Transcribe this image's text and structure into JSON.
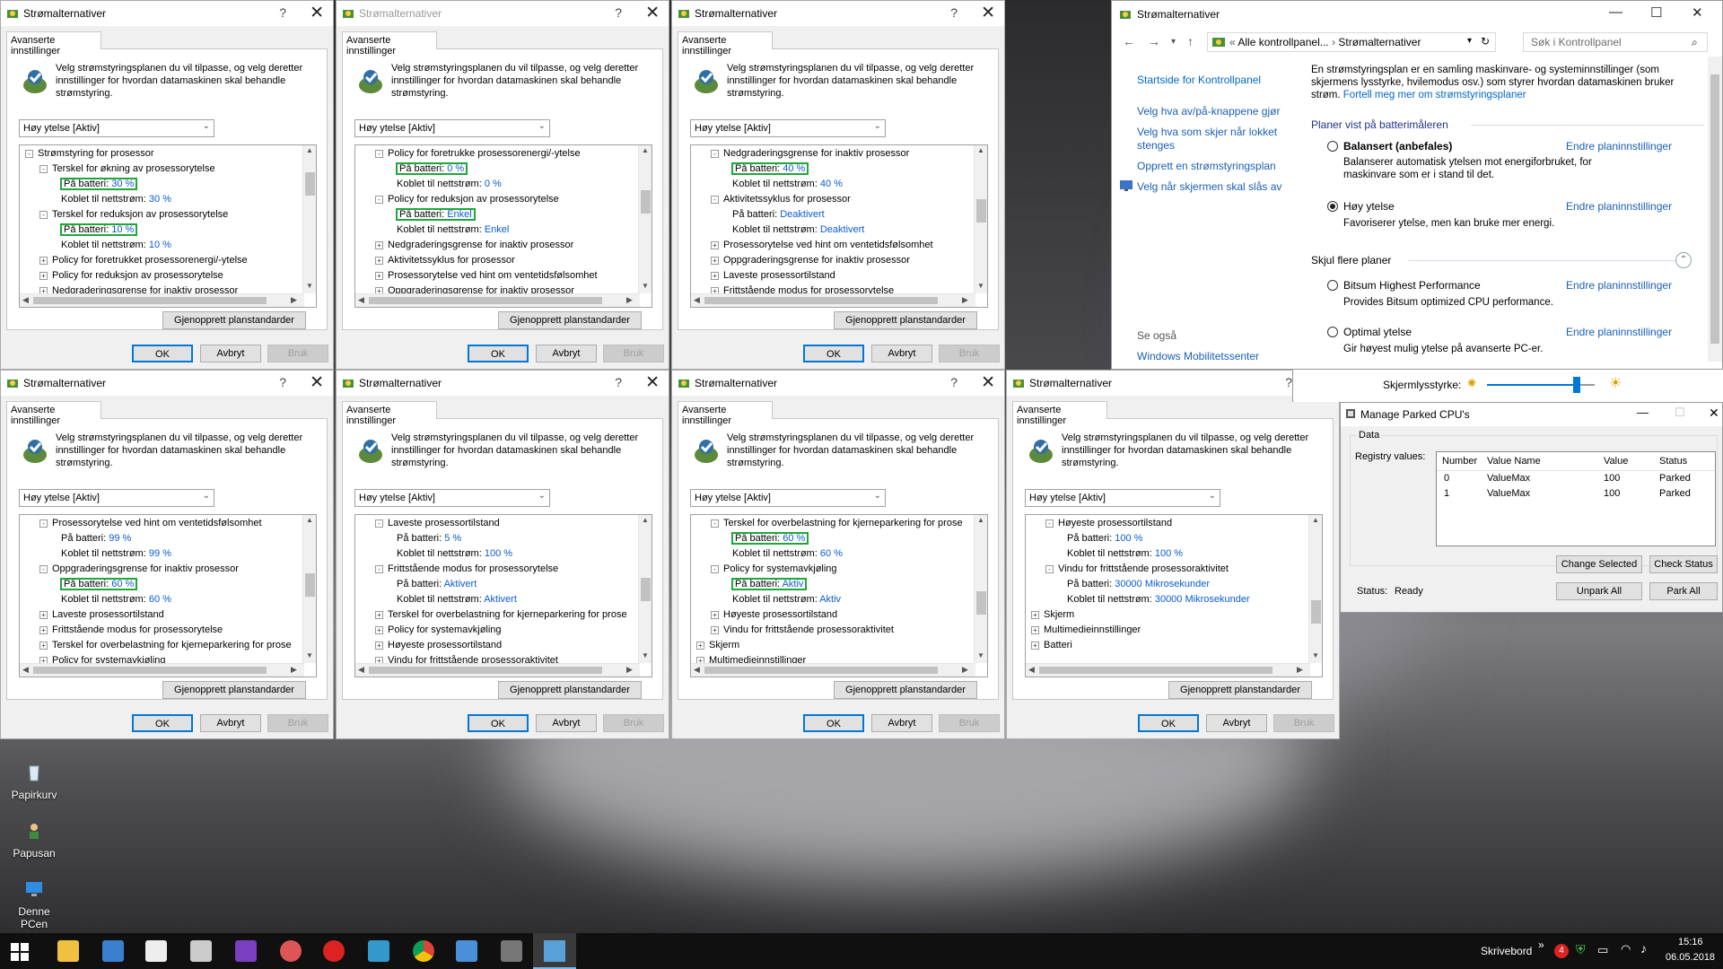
{
  "dialog_common": {
    "title": "Strømalternativer",
    "help": "?",
    "close": "✕",
    "tab": "Avanserte innstillinger",
    "description": "Velg strømstyringsplanen du vil tilpasse, og velg deretter innstillinger for hvordan datamaskinen skal behandle strømstyring.",
    "plan_select": "Høy ytelse [Aktiv]",
    "restore": "Gjenopprett planstandarder",
    "ok": "OK",
    "cancel": "Avbryt",
    "apply": "Bruk"
  },
  "dialogs": [
    {
      "rows": [
        {
          "t": "Strømstyring for prosessor",
          "lvl": 0,
          "exp": "-"
        },
        {
          "t": "Terskel for økning av prosessorytelse",
          "lvl": 1,
          "exp": "-"
        },
        {
          "t": "På batteri:",
          "v": "30 %",
          "lvl": 2,
          "hl": true
        },
        {
          "t": "Koblet til nettstrøm:",
          "v": "30 %",
          "lvl": 2
        },
        {
          "t": "Terskel for reduksjon av prosessorytelse",
          "lvl": 1,
          "exp": "-"
        },
        {
          "t": "På batteri:",
          "v": "10 %",
          "lvl": 2,
          "hl": true
        },
        {
          "t": "Koblet til nettstrøm:",
          "v": "10 %",
          "lvl": 2
        },
        {
          "t": "Policy for foretrukket prosessorenergi/-ytelse",
          "lvl": 1,
          "exp": "+"
        },
        {
          "t": "Policy for reduksjon av prosessorytelse",
          "lvl": 1,
          "exp": "+"
        },
        {
          "t": "Nedgraderingsgrense for inaktiv prosessor",
          "lvl": 1,
          "exp": "+"
        }
      ]
    },
    {
      "rows": [
        {
          "t": "Policy for foretrukke prosessorenergi/-ytelse",
          "lvl": 1,
          "exp": "-"
        },
        {
          "t": "På batteri:",
          "v": "0 %",
          "lvl": 2,
          "hl": true
        },
        {
          "t": "Koblet til nettstrøm:",
          "v": "0 %",
          "lvl": 2
        },
        {
          "t": "Policy for reduksjon av prosessorytelse",
          "lvl": 1,
          "exp": "-"
        },
        {
          "t": "På batteri:",
          "v": "Enkel",
          "lvl": 2,
          "hl": true
        },
        {
          "t": "Koblet til nettstrøm:",
          "v": "Enkel",
          "lvl": 2
        },
        {
          "t": "Nedgraderingsgrense for inaktiv prosessor",
          "lvl": 1,
          "exp": "+"
        },
        {
          "t": "Aktivitetssyklus for prosessor",
          "lvl": 1,
          "exp": "+"
        },
        {
          "t": "Prosessorytelse ved hint om ventetidsfølsomhet",
          "lvl": 1,
          "exp": "+"
        },
        {
          "t": "Oppgraderingsgrense for inaktiv prosessor",
          "lvl": 1,
          "exp": "+"
        }
      ]
    },
    {
      "rows": [
        {
          "t": "Nedgraderingsgrense for inaktiv prosessor",
          "lvl": 1,
          "exp": "-"
        },
        {
          "t": "På batteri:",
          "v": "40 %",
          "lvl": 2,
          "hl": true
        },
        {
          "t": "Koblet til nettstrøm:",
          "v": "40 %",
          "lvl": 2
        },
        {
          "t": "Aktivitetssyklus for prosessor",
          "lvl": 1,
          "exp": "-"
        },
        {
          "t": "På batteri:",
          "v": "Deaktivert",
          "lvl": 2
        },
        {
          "t": "Koblet til nettstrøm:",
          "v": "Deaktivert",
          "lvl": 2
        },
        {
          "t": "Prosessorytelse ved hint om ventetidsfølsomhet",
          "lvl": 1,
          "exp": "+"
        },
        {
          "t": "Oppgraderingsgrense for inaktiv prosessor",
          "lvl": 1,
          "exp": "+"
        },
        {
          "t": "Laveste prosessortilstand",
          "lvl": 1,
          "exp": "+"
        },
        {
          "t": "Frittstående modus for prosessorytelse",
          "lvl": 1,
          "exp": "+"
        }
      ]
    },
    {
      "rows": [
        {
          "t": "Prosessorytelse ved hint om ventetidsfølsomhet",
          "lvl": 1,
          "exp": "-"
        },
        {
          "t": "På batteri:",
          "v": "99 %",
          "lvl": 2
        },
        {
          "t": "Koblet til nettstrøm:",
          "v": "99 %",
          "lvl": 2
        },
        {
          "t": "Oppgraderingsgrense for inaktiv prosessor",
          "lvl": 1,
          "exp": "-"
        },
        {
          "t": "På batteri:",
          "v": "60 %",
          "lvl": 2,
          "hl": true
        },
        {
          "t": "Koblet til nettstrøm:",
          "v": "60 %",
          "lvl": 2
        },
        {
          "t": "Laveste prosessortilstand",
          "lvl": 1,
          "exp": "+"
        },
        {
          "t": "Frittstående modus for prosessorytelse",
          "lvl": 1,
          "exp": "+"
        },
        {
          "t": "Terskel for overbelastning for kjerneparkering for prose",
          "lvl": 1,
          "exp": "+"
        },
        {
          "t": "Policy for systemavkjøling",
          "lvl": 1,
          "exp": "+"
        }
      ]
    },
    {
      "rows": [
        {
          "t": "Laveste prosessortilstand",
          "lvl": 1,
          "exp": "-"
        },
        {
          "t": "På batteri:",
          "v": "5 %",
          "lvl": 2
        },
        {
          "t": "Koblet til nettstrøm:",
          "v": "100 %",
          "lvl": 2
        },
        {
          "t": "Frittstående modus for prosessorytelse",
          "lvl": 1,
          "exp": "-"
        },
        {
          "t": "På batteri:",
          "v": "Aktivert",
          "lvl": 2
        },
        {
          "t": "Koblet til nettstrøm:",
          "v": "Aktivert",
          "lvl": 2
        },
        {
          "t": "Terskel for overbelastning for kjerneparkering for prose",
          "lvl": 1,
          "exp": "+"
        },
        {
          "t": "Policy for systemavkjøling",
          "lvl": 1,
          "exp": "+"
        },
        {
          "t": "Høyeste prosessortilstand",
          "lvl": 1,
          "exp": "+"
        },
        {
          "t": "Vindu for frittstående prosessoraktivitet",
          "lvl": 1,
          "exp": "+"
        }
      ]
    },
    {
      "rows": [
        {
          "t": "Terskel for overbelastning for kjerneparkering for prose",
          "lvl": 1,
          "exp": "-"
        },
        {
          "t": "På batteri:",
          "v": "60 %",
          "lvl": 2,
          "hl": true
        },
        {
          "t": "Koblet til nettstrøm:",
          "v": "60 %",
          "lvl": 2
        },
        {
          "t": "Policy for systemavkjøling",
          "lvl": 1,
          "exp": "-"
        },
        {
          "t": "På batteri:",
          "v": "Aktiv",
          "lvl": 2,
          "hl": true
        },
        {
          "t": "Koblet til nettstrøm:",
          "v": "Aktiv",
          "lvl": 2
        },
        {
          "t": "Høyeste prosessortilstand",
          "lvl": 1,
          "exp": "+"
        },
        {
          "t": "Vindu for frittstående prosessoraktivitet",
          "lvl": 1,
          "exp": "+"
        },
        {
          "t": "Skjerm",
          "lvl": 0,
          "exp": "+"
        },
        {
          "t": "Multimedieinnstillinger",
          "lvl": 0,
          "exp": "+"
        }
      ]
    },
    {
      "rows": [
        {
          "t": "Høyeste prosessortilstand",
          "lvl": 1,
          "exp": "-"
        },
        {
          "t": "På batteri:",
          "v": "100 %",
          "lvl": 2
        },
        {
          "t": "Koblet til nettstrøm:",
          "v": "100 %",
          "lvl": 2
        },
        {
          "t": "Vindu for frittstående prosessoraktivitet",
          "lvl": 1,
          "exp": "-"
        },
        {
          "t": "På batteri:",
          "v": "30000 Mikrosekunder",
          "lvl": 2
        },
        {
          "t": "Koblet til nettstrøm:",
          "v": "30000 Mikrosekunder",
          "lvl": 2
        },
        {
          "t": "Skjerm",
          "lvl": 0,
          "exp": "+"
        },
        {
          "t": "Multimedieinnstillinger",
          "lvl": 0,
          "exp": "+"
        },
        {
          "t": "Batteri",
          "lvl": 0,
          "exp": "+"
        }
      ]
    }
  ],
  "control_panel": {
    "title": "Strømalternativer",
    "minimize": "—",
    "maximize": "☐",
    "close": "✕",
    "breadcrumb_root": "Alle kontrollpanel...",
    "breadcrumb_current": "Strømalternativer",
    "search_placeholder": "Søk i Kontrollpanel",
    "sidebar": [
      "Startside for Kontrollpanel",
      "Velg hva av/på-knappene gjør",
      "Velg hva som skjer når lokket",
      "stenges",
      "Opprett en strømstyringsplan",
      "Velg når skjermen skal slås av"
    ],
    "see_also": "Se også",
    "mobility": "Windows Mobilitetssenter",
    "intro": "En strømstyringsplan er en samling maskinvare- og systeminnstillinger (som skjermens lysstyrke, hvilemodus osv.) som styrer hvordan datamaskinen bruker strøm.",
    "intro_link": "Fortell meg mer om strømstyringsplaner",
    "section1": "Planer vist på batterimåleren",
    "section2": "Skjul flere planer",
    "change_plan": "Endre planinnstillinger",
    "plans": [
      {
        "name": "Balansert (anbefales)",
        "desc": "Balanserer automatisk ytelsen mot energiforbruket, for maskinvare som er i stand til det.",
        "selected": false
      },
      {
        "name": "Høy ytelse",
        "desc": "Favoriserer ytelse, men kan bruke mer energi.",
        "selected": true
      },
      {
        "name": "Bitsum Highest Performance",
        "desc": "Provides Bitsum optimized CPU performance.",
        "selected": false
      },
      {
        "name": "Optimal ytelse",
        "desc": "Gir høyest mulig ytelse på avanserte PC-er.",
        "selected": false
      }
    ],
    "brightness_label": "Skjermlysstyrke:"
  },
  "parked": {
    "title": "Manage Parked CPU's",
    "data_label": "Data",
    "registry_label": "Registry values:",
    "columns": [
      "Number",
      "Value Name",
      "Value",
      "Status"
    ],
    "rows": [
      [
        "0",
        "ValueMax",
        "100",
        "Parked"
      ],
      [
        "1",
        "ValueMax",
        "100",
        "Parked"
      ]
    ],
    "change_selected": "Change Selected",
    "check_status": "Check Status",
    "status_label": "Status:",
    "status_value": "Ready",
    "unpark_all": "Unpark All",
    "park_all": "Park All"
  },
  "desktop": {
    "icons": [
      "Papirkurv",
      "Papusan",
      "Denne PCen"
    ]
  },
  "taskbar": {
    "desktop_label": "Skrivebord",
    "chevron": "»",
    "badge": "4",
    "time": "15:16",
    "date": "06.05.2018"
  },
  "colors": {
    "accent": "#0078d7",
    "highlight_box": "#1ea838",
    "value_text": "#0b5bd3",
    "link": "#1a5fb4"
  }
}
